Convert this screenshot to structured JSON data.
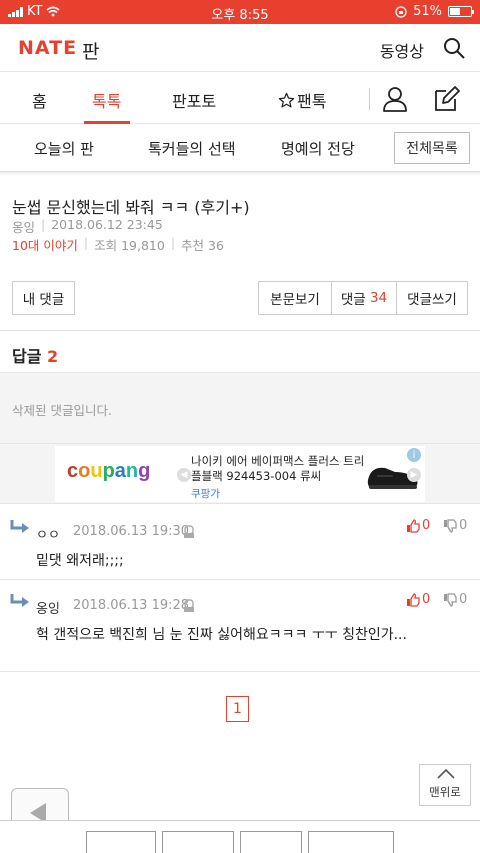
{
  "status_bar": {
    "carrier": "KT",
    "time": "오후 8:55",
    "battery": "51%",
    "battery_level": 0.51
  },
  "header": {
    "logo": "NATE",
    "logo_sub": "판",
    "video_link": "동영상",
    "search_icon": "search-icon"
  },
  "tabs": [
    {
      "label": "홈"
    },
    {
      "label": "톡톡",
      "active": true
    },
    {
      "label": "판포토"
    },
    {
      "label": "팬톡",
      "icon": "star-outline-icon"
    }
  ],
  "subnav": {
    "items": [
      "오늘의 판",
      "톡커들의 선택",
      "명예의 전당"
    ],
    "all_list": "전체목록"
  },
  "post": {
    "title": "눈썹 문신했는데 봐줘 ㅋㅋ (후기+)",
    "author": "옹잉",
    "date": "2018.06.12 23:45",
    "category": "10대 이야기",
    "views": "조회 19,810",
    "recommends": "추천 36"
  },
  "actions": {
    "my_comments": "내 댓글",
    "view_body": "본문보기",
    "comments_label": "댓글",
    "comments_count": "34",
    "write_comment": "댓글쓰기"
  },
  "replies": {
    "title": "답글",
    "count": "2",
    "deleted_text": "삭제된 댓글입니다."
  },
  "ad": {
    "brand": "coupang",
    "text": "나이키 에어 베이퍼맥스 플러스 트리플블랙 924453-004 류씨",
    "source": "쿠팡가",
    "info": "i",
    "brand_colors": [
      "#c0392b",
      "#e57e25",
      "#f1c40f",
      "#27ae60",
      "#2980b9",
      "#1abc9c",
      "#8e44ad"
    ]
  },
  "reply_list": [
    {
      "author": "ㅇㅇ",
      "date": "2018.06.13 19:30",
      "body": "밑댓 왜저래;;;;",
      "up": "0",
      "down": "0"
    },
    {
      "author": "옹잉",
      "date": "2018.06.13 19:28",
      "body": "헉 갠적으로 백진희 님 눈 진짜 싫어해요ㅋㅋㅋ ㅜㅜ 칭찬인가...",
      "up": "0",
      "down": "0"
    }
  ],
  "pagination": {
    "current": "1"
  },
  "to_top": "맨위로"
}
